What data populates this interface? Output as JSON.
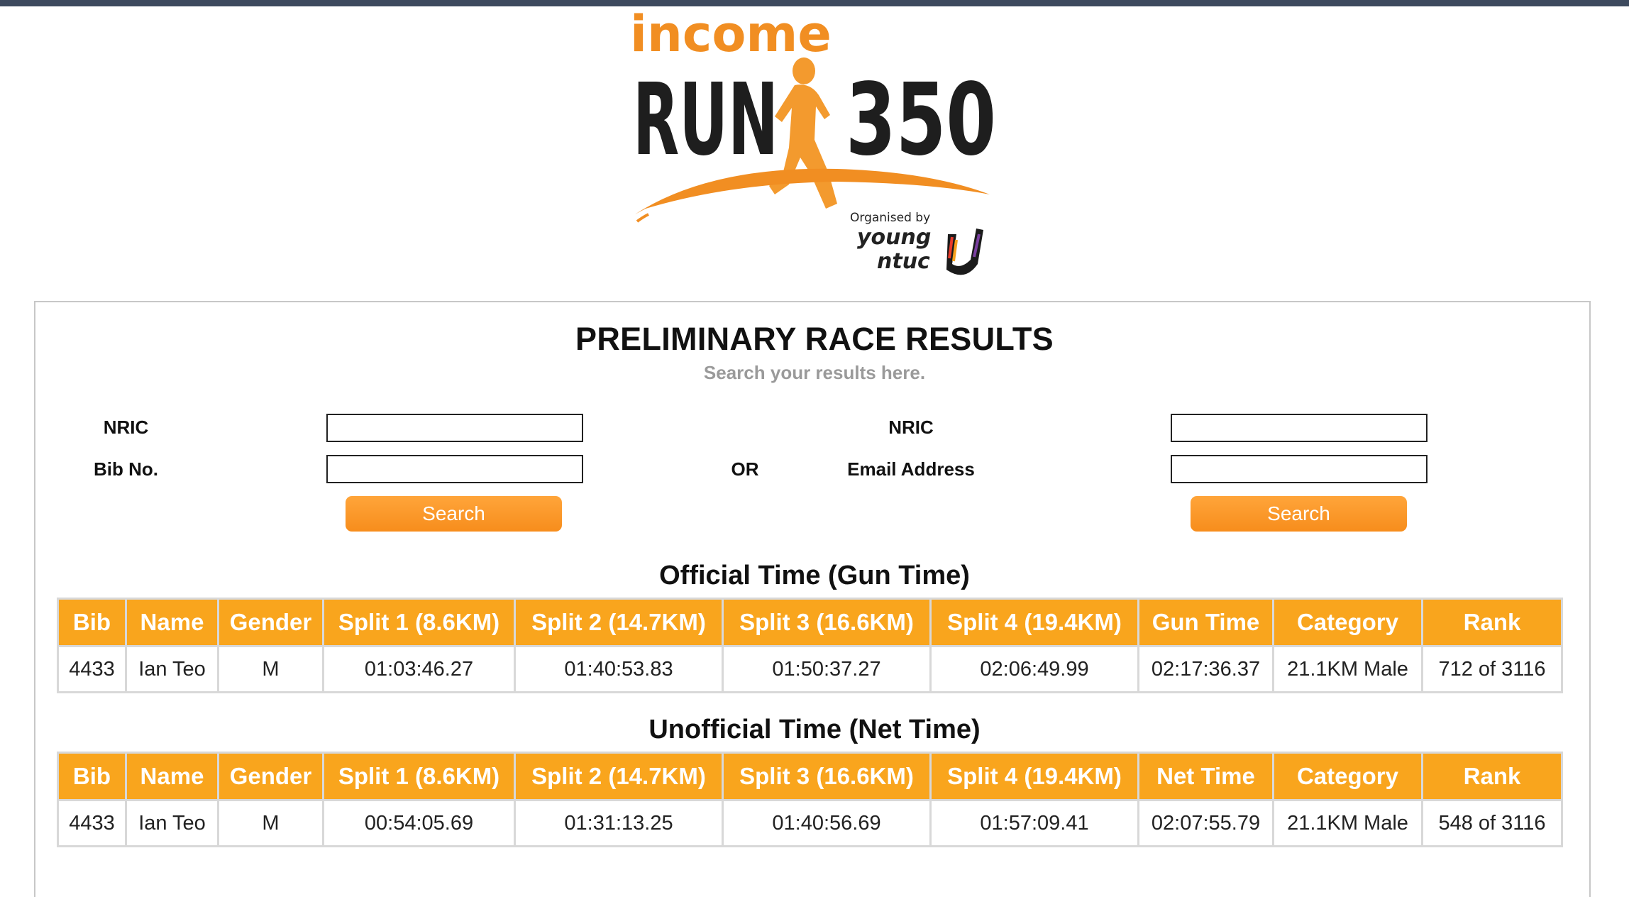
{
  "logo": {
    "brand": "income",
    "run_text": "RUN",
    "number_text": "350",
    "organised_by": "Organised by",
    "org_line1": "young",
    "org_line2": "ntuc"
  },
  "header": {
    "title": "PRELIMINARY RACE RESULTS",
    "subtitle": "Search your results here."
  },
  "search": {
    "left": {
      "label1": "NRIC",
      "label2": "Bib No.",
      "value1": "",
      "value2": "",
      "button": "Search"
    },
    "or_text": "OR",
    "right": {
      "label1": "NRIC",
      "label2": "Email Address",
      "value1": "",
      "value2": "",
      "button": "Search"
    }
  },
  "official": {
    "title": "Official Time (Gun Time)",
    "headers": [
      "Bib",
      "Name",
      "Gender",
      "Split 1 (8.6KM)",
      "Split 2 (14.7KM)",
      "Split 3 (16.6KM)",
      "Split 4 (19.4KM)",
      "Gun Time",
      "Category",
      "Rank"
    ],
    "row": [
      "4433",
      "Ian Teo",
      "M",
      "01:03:46.27",
      "01:40:53.83",
      "01:50:37.27",
      "02:06:49.99",
      "02:17:36.37",
      "21.1KM Male",
      "712 of 3116"
    ]
  },
  "unofficial": {
    "title": "Unofficial Time (Net Time)",
    "headers": [
      "Bib",
      "Name",
      "Gender",
      "Split 1 (8.6KM)",
      "Split 2 (14.7KM)",
      "Split 3 (16.6KM)",
      "Split 4 (19.4KM)",
      "Net Time",
      "Category",
      "Rank"
    ],
    "row": [
      "4433",
      "Ian Teo",
      "M",
      "00:54:05.69",
      "01:31:13.25",
      "01:40:56.69",
      "01:57:09.41",
      "02:07:55.79",
      "21.1KM Male",
      "548 of 3116"
    ]
  },
  "colors": {
    "accent": "#f9a51d",
    "button": "#f78d1c",
    "topbar": "#3d4a5e"
  }
}
